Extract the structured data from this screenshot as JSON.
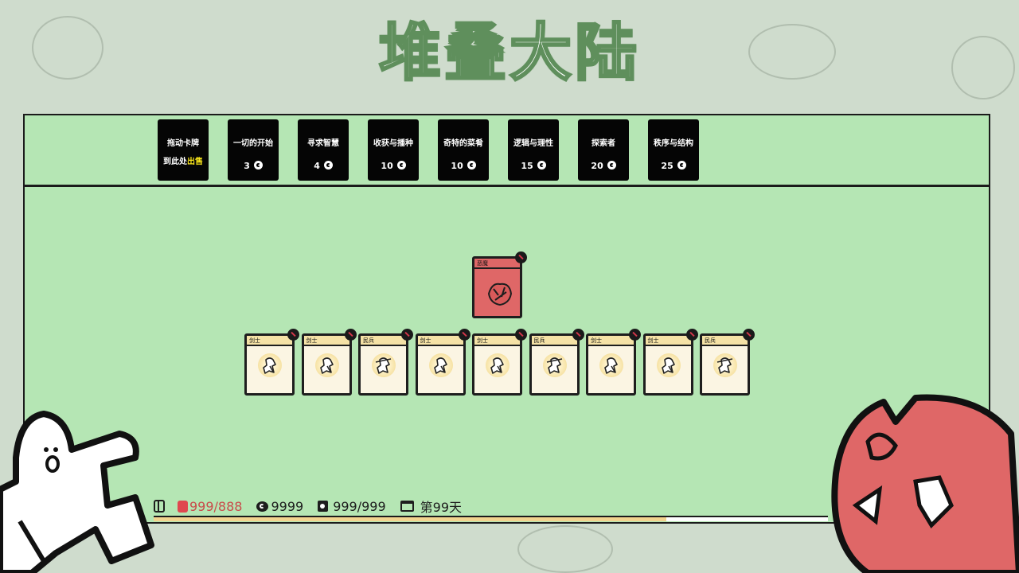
{
  "title": "堆叠大陆",
  "shop": {
    "sell_slot": {
      "line1": "拖动卡牌",
      "line2_prefix": "到此处",
      "line2_highlight": "出售"
    },
    "packs": [
      {
        "name": "一切的开始",
        "price": "3"
      },
      {
        "name": "寻求智慧",
        "price": "4"
      },
      {
        "name": "收获与播种",
        "price": "10"
      },
      {
        "name": "奇特的菜肴",
        "price": "10"
      },
      {
        "name": "逻辑与理性",
        "price": "15"
      },
      {
        "name": "探索者",
        "price": "20"
      },
      {
        "name": "秩序与结构",
        "price": "25"
      }
    ]
  },
  "board": {
    "enemy_card": {
      "label": "恶魔",
      "icon": "demon-icon"
    },
    "cards": [
      {
        "label": "剑士",
        "icon": "swordsman-icon"
      },
      {
        "label": "剑士",
        "icon": "swordsman-icon"
      },
      {
        "label": "民兵",
        "icon": "militia-icon"
      },
      {
        "label": "剑士",
        "icon": "swordsman-icon"
      },
      {
        "label": "剑士",
        "icon": "swordsman-icon"
      },
      {
        "label": "民兵",
        "icon": "militia-icon"
      },
      {
        "label": "剑士",
        "icon": "swordsman-icon"
      },
      {
        "label": "剑士",
        "icon": "swordsman-icon"
      },
      {
        "label": "民兵",
        "icon": "militia-icon"
      }
    ]
  },
  "status": {
    "health": "999/888",
    "coins": "9999",
    "food": "999/999",
    "day": "第99天"
  },
  "day_progress_percent": 76,
  "colors": {
    "board_bg": "#b5e6b4",
    "enemy": "#df6767",
    "card_bg": "#fbf5e3",
    "card_label": "#f5e2a6",
    "health_text": "#c94a4a",
    "sell_highlight": "#f5e21a",
    "progress_fill": "#f2d48f"
  }
}
